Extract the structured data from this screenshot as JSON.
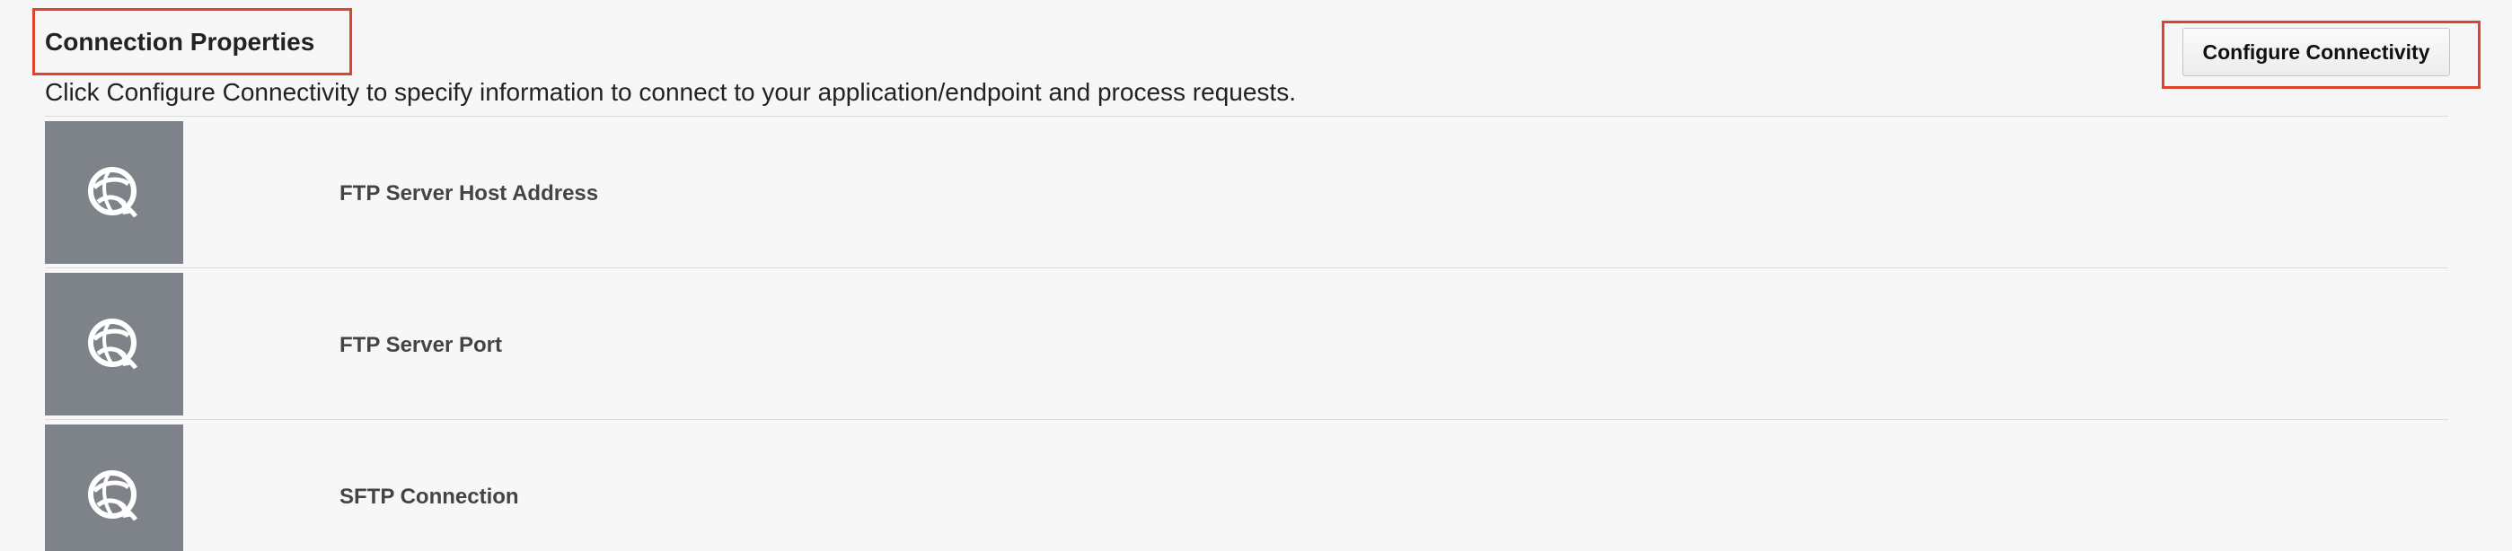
{
  "section": {
    "title": "Connection Properties",
    "description": "Click Configure Connectivity to specify information to connect to your application/endpoint and process requests."
  },
  "toolbar": {
    "configure_label": "Configure Connectivity"
  },
  "properties": [
    {
      "label": "FTP Server Host Address",
      "icon": "connectivity-globe-icon"
    },
    {
      "label": "FTP Server Port",
      "icon": "connectivity-globe-icon"
    },
    {
      "label": "SFTP Connection",
      "icon": "connectivity-globe-icon"
    }
  ],
  "colors": {
    "highlight": "#e0442a",
    "icon_tile": "#7e838a",
    "background": "#f7f7f7"
  }
}
